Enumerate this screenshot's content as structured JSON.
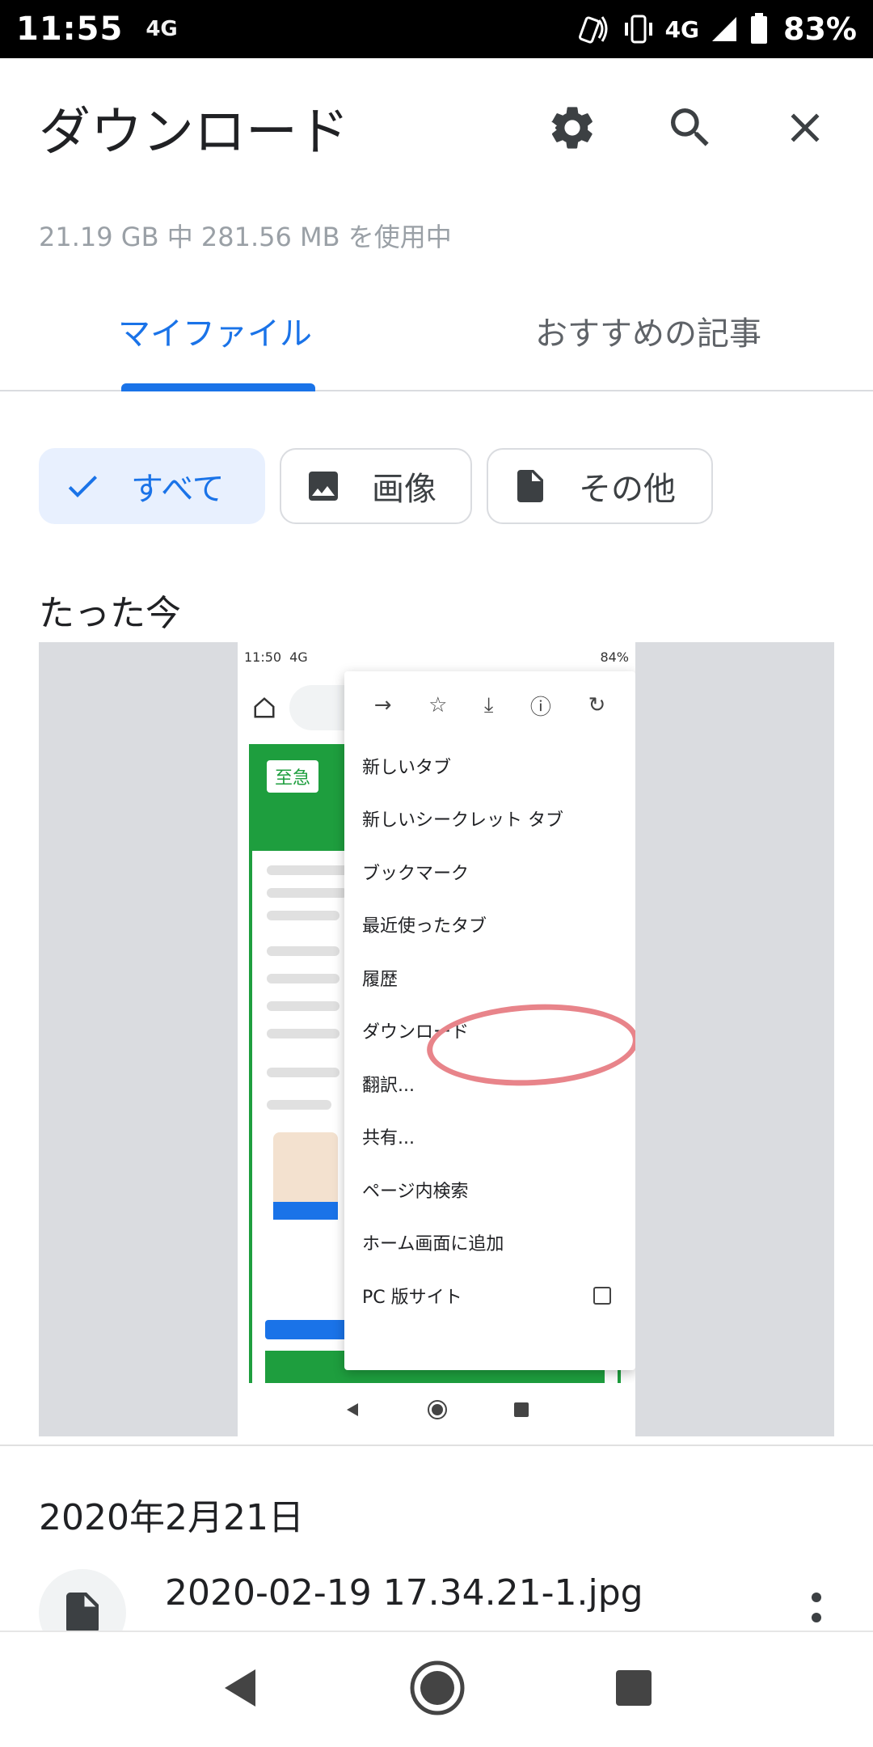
{
  "status_bar": {
    "time": "11:55",
    "network_label": "4G",
    "mobile_label": "4G",
    "battery": "83%"
  },
  "header": {
    "title": "ダウンロード",
    "storage_text": "21.19 GB 中 281.56 MB を使用中"
  },
  "tabs": [
    {
      "label": "マイファイル",
      "active": true
    },
    {
      "label": "おすすめの記事",
      "active": false
    }
  ],
  "filters": [
    {
      "label": "すべて",
      "selected": true,
      "icon": "check-icon"
    },
    {
      "label": "画像",
      "selected": false,
      "icon": "image-icon"
    },
    {
      "label": "その他",
      "selected": false,
      "icon": "file-icon"
    }
  ],
  "sections": {
    "now": "たった今",
    "date": "2020年2月21日"
  },
  "thumbnail": {
    "status_time": "11:50",
    "status_network": "4G",
    "status_battery": "84%",
    "tag": "至急",
    "menu_items": [
      "新しいタブ",
      "新しいシークレット タブ",
      "ブックマーク",
      "最近使ったタブ",
      "履歴",
      "ダウンロード",
      "翻訳...",
      "共有...",
      "ページ内検索",
      "ホーム画面に追加",
      "PC 版サイト"
    ],
    "highlight_item": "ダウンロード"
  },
  "files": [
    {
      "name": "2020-02-19 17.34.21-1.jpg",
      "icon": "file-icon"
    }
  ],
  "colors": {
    "accent": "#1a73e8",
    "chip_selected_bg": "#e8f0fe",
    "secondary_text": "#9aa0a6",
    "highlight_circle": "#e8848a"
  }
}
